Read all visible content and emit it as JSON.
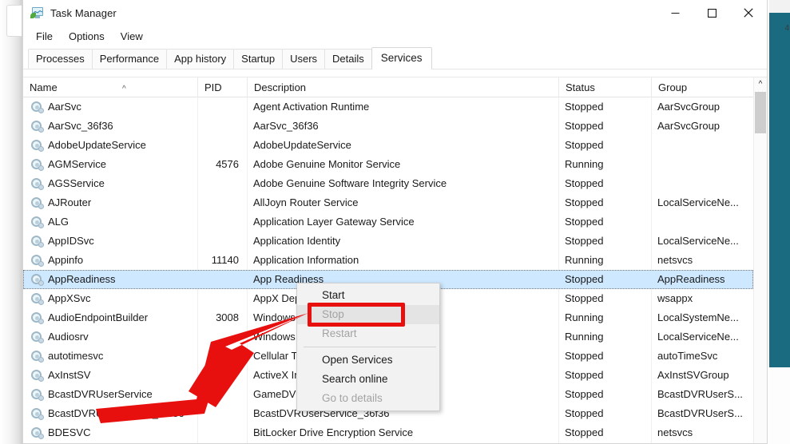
{
  "window": {
    "title": "Task Manager",
    "icon": "task-manager-icon",
    "controls": {
      "minimize": "minimize-icon",
      "maximize": "maximize-icon",
      "close": "close-icon"
    }
  },
  "menubar": {
    "items": [
      {
        "label": "File"
      },
      {
        "label": "Options"
      },
      {
        "label": "View"
      }
    ]
  },
  "tabs": {
    "items": [
      {
        "label": "Processes",
        "active": false
      },
      {
        "label": "Performance",
        "active": false
      },
      {
        "label": "App history",
        "active": false
      },
      {
        "label": "Startup",
        "active": false
      },
      {
        "label": "Users",
        "active": false
      },
      {
        "label": "Details",
        "active": false
      },
      {
        "label": "Services",
        "active": true
      }
    ]
  },
  "table": {
    "columns": [
      {
        "key": "name",
        "label": "Name",
        "sort": "ascending",
        "sort_glyph": "^"
      },
      {
        "key": "pid",
        "label": "PID"
      },
      {
        "key": "description",
        "label": "Description"
      },
      {
        "key": "status",
        "label": "Status"
      },
      {
        "key": "group",
        "label": "Group"
      }
    ],
    "rows": [
      {
        "name": "AarSvc",
        "pid": "",
        "description": "Agent Activation Runtime",
        "status": "Stopped",
        "group": "AarSvcGroup",
        "selected": false
      },
      {
        "name": "AarSvc_36f36",
        "pid": "",
        "description": "AarSvc_36f36",
        "status": "Stopped",
        "group": "AarSvcGroup",
        "selected": false
      },
      {
        "name": "AdobeUpdateService",
        "pid": "",
        "description": "AdobeUpdateService",
        "status": "Stopped",
        "group": "",
        "selected": false
      },
      {
        "name": "AGMService",
        "pid": "4576",
        "description": "Adobe Genuine Monitor Service",
        "status": "Running",
        "group": "",
        "selected": false
      },
      {
        "name": "AGSService",
        "pid": "",
        "description": "Adobe Genuine Software Integrity Service",
        "status": "Stopped",
        "group": "",
        "selected": false
      },
      {
        "name": "AJRouter",
        "pid": "",
        "description": "AllJoyn Router Service",
        "status": "Stopped",
        "group": "LocalServiceNe...",
        "selected": false
      },
      {
        "name": "ALG",
        "pid": "",
        "description": "Application Layer Gateway Service",
        "status": "Stopped",
        "group": "",
        "selected": false
      },
      {
        "name": "AppIDSvc",
        "pid": "",
        "description": "Application Identity",
        "status": "Stopped",
        "group": "LocalServiceNe...",
        "selected": false
      },
      {
        "name": "Appinfo",
        "pid": "11140",
        "description": "Application Information",
        "status": "Running",
        "group": "netsvcs",
        "selected": false
      },
      {
        "name": "AppReadiness",
        "pid": "",
        "description": "App Readiness",
        "status": "Stopped",
        "group": "AppReadiness",
        "selected": true
      },
      {
        "name": "AppXSvc",
        "pid": "",
        "description": "AppX Deployment Service (AppXSVC)",
        "status": "Stopped",
        "group": "wsappx",
        "selected": false
      },
      {
        "name": "AudioEndpointBuilder",
        "pid": "3008",
        "description": "Windows Audio Endpoint Builder",
        "status": "Running",
        "group": "LocalSystemNe...",
        "selected": false
      },
      {
        "name": "Audiosrv",
        "pid": "",
        "description": "Windows Audio",
        "status": "Running",
        "group": "LocalServiceNe...",
        "selected": false
      },
      {
        "name": "autotimesvc",
        "pid": "",
        "description": "Cellular Time",
        "status": "Stopped",
        "group": "autoTimeSvc",
        "selected": false
      },
      {
        "name": "AxInstSV",
        "pid": "",
        "description": "ActiveX Installer (AxInstSV)",
        "status": "Stopped",
        "group": "AxInstSVGroup",
        "selected": false
      },
      {
        "name": "BcastDVRUserService",
        "pid": "",
        "description": "GameDVR and Broadcast User Service",
        "status": "Stopped",
        "group": "BcastDVRUserS...",
        "selected": false
      },
      {
        "name": "BcastDVRUserService_36f36",
        "pid": "",
        "description": "BcastDVRUserService_36f36",
        "status": "Stopped",
        "group": "BcastDVRUserS...",
        "selected": false
      },
      {
        "name": "BDESVC",
        "pid": "",
        "description": "BitLocker Drive Encryption Service",
        "status": "Stopped",
        "group": "netsvcs",
        "selected": false
      }
    ]
  },
  "context_menu": {
    "items": [
      {
        "label": "Start",
        "disabled": false,
        "hover": false,
        "separator_after": false
      },
      {
        "label": "Stop",
        "disabled": true,
        "hover": true,
        "separator_after": false
      },
      {
        "label": "Restart",
        "disabled": true,
        "hover": false,
        "separator_after": true
      },
      {
        "label": "Open Services",
        "disabled": false,
        "hover": false,
        "separator_after": false
      },
      {
        "label": "Search online",
        "disabled": false,
        "hover": false,
        "separator_after": false
      },
      {
        "label": "Go to details",
        "disabled": true,
        "hover": false,
        "separator_after": false
      }
    ]
  },
  "scrollbar": {
    "up_arrow": "^"
  },
  "annotations": {
    "highlight_color": "#e8100f",
    "highlight_target": "Stop",
    "arrow_color": "#e8100f",
    "arrow_points_to": "Stop"
  },
  "background": {
    "accent_color": "#1b6b80",
    "edge_text_top": "4"
  }
}
